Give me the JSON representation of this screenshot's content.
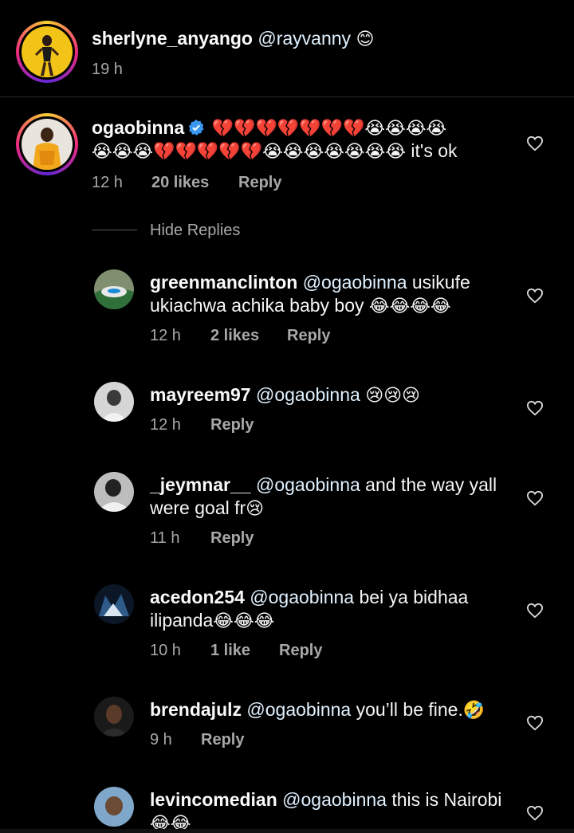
{
  "top_comment": {
    "username": "sherlyne_anyango",
    "mention": "@rayvanny",
    "emoji": "😊",
    "time": "19 h"
  },
  "main_comment": {
    "username": "ogaobinna",
    "verified": true,
    "emoji_line1": "💔💔💔💔💔💔💔😭😭😭😭",
    "emoji_line2": "😭😭😭💔💔💔💔💔😭😭😭😭😭😭😭",
    "text_tail": "it's ok",
    "time": "12 h",
    "likes": "20 likes",
    "reply_label": "Reply"
  },
  "hide_replies_label": "Hide Replies",
  "replies": [
    {
      "username": "greenmanclinton",
      "mention": "@ogaobinna",
      "text": "usikufe ukiachwa achika baby boy",
      "emoji": "😂😂😂😂",
      "time": "12 h",
      "likes": "2 likes",
      "reply_label": "Reply"
    },
    {
      "username": "mayreem97",
      "mention": "@ogaobinna",
      "text": "",
      "emoji": "😢😢😢",
      "time": "12 h",
      "likes": "",
      "reply_label": "Reply"
    },
    {
      "username": "_jeymnar__",
      "mention": "@ogaobinna",
      "text": "and the way yall were goal fr",
      "emoji": "😢",
      "time": "11 h",
      "likes": "",
      "reply_label": "Reply"
    },
    {
      "username": "acedon254",
      "mention": "@ogaobinna",
      "text": "bei ya bidhaa ilipanda",
      "emoji": "😂😂😂",
      "time": "10 h",
      "likes": "1 like",
      "reply_label": "Reply"
    },
    {
      "username": "brendajulz",
      "mention": "@ogaobinna",
      "text": "you’ll be fine.",
      "emoji": "🤣",
      "time": "9 h",
      "likes": "",
      "reply_label": "Reply"
    },
    {
      "username": "levincomedian",
      "mention": "@ogaobinna",
      "text": "this is Nairobi",
      "emoji": "😂😂",
      "time": "",
      "likes": "",
      "reply_label": ""
    }
  ],
  "colors": {
    "background": "#000000",
    "meta_text": "#a8a8a8",
    "verified_blue": "#3897f0",
    "story_ring_start": "#f9ce34",
    "story_ring_end": "#ee2a7b"
  },
  "icons": [
    "heart-outline-icon",
    "verified-badge-icon"
  ]
}
